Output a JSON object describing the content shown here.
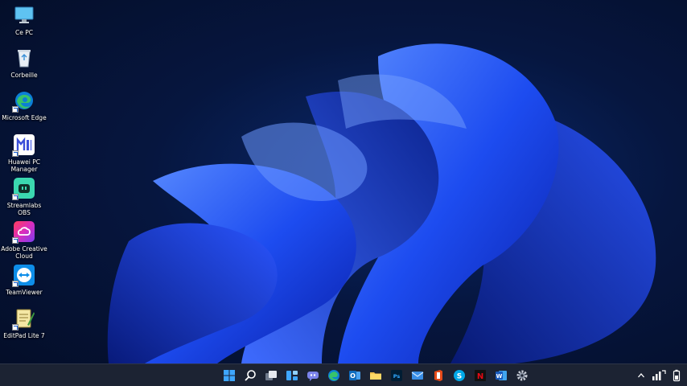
{
  "desktop": {
    "icons": [
      {
        "label": "Ce PC",
        "icon": "monitor-icon"
      },
      {
        "label": "Corbeille",
        "icon": "recycle-bin-icon"
      },
      {
        "label": "Microsoft Edge",
        "icon": "edge-icon"
      },
      {
        "label": "Huawei PC Manager",
        "icon": "huawei-pc-manager-icon"
      },
      {
        "label": "Streamlabs OBS",
        "icon": "streamlabs-obs-icon"
      },
      {
        "label": "Adobe Creative Cloud",
        "icon": "adobe-creative-cloud-icon"
      },
      {
        "label": "TeamViewer",
        "icon": "teamviewer-icon"
      },
      {
        "label": "EditPad Lite 7",
        "icon": "editpad-icon"
      }
    ]
  },
  "taskbar": {
    "apps": [
      {
        "name": "start",
        "icon": "windows-start-icon"
      },
      {
        "name": "search",
        "icon": "search-icon"
      },
      {
        "name": "task-view",
        "icon": "task-view-icon"
      },
      {
        "name": "widgets",
        "icon": "widgets-icon"
      },
      {
        "name": "chat",
        "icon": "chat-icon"
      },
      {
        "name": "edge",
        "icon": "edge-icon"
      },
      {
        "name": "outlook",
        "icon": "outlook-icon",
        "text": "O"
      },
      {
        "name": "file-explorer",
        "icon": "folder-icon"
      },
      {
        "name": "photoshop",
        "icon": "photoshop-icon",
        "text": "Ps"
      },
      {
        "name": "mail",
        "icon": "mail-icon"
      },
      {
        "name": "office",
        "icon": "office-icon"
      },
      {
        "name": "skype",
        "icon": "skype-icon",
        "text": "S"
      },
      {
        "name": "netflix",
        "icon": "netflix-icon",
        "text": "N"
      },
      {
        "name": "word",
        "icon": "word-icon",
        "text": "W"
      },
      {
        "name": "settings",
        "icon": "gear-icon"
      }
    ],
    "tray": [
      {
        "name": "show-hidden",
        "icon": "chevron-up-icon"
      },
      {
        "name": "network",
        "icon": "network-icon"
      },
      {
        "name": "battery",
        "icon": "battery-icon"
      }
    ]
  },
  "colors": {
    "taskbar_bg": "#1c2333",
    "accent": "#1a5fd0",
    "wallpaper_deep": "#040d26"
  }
}
